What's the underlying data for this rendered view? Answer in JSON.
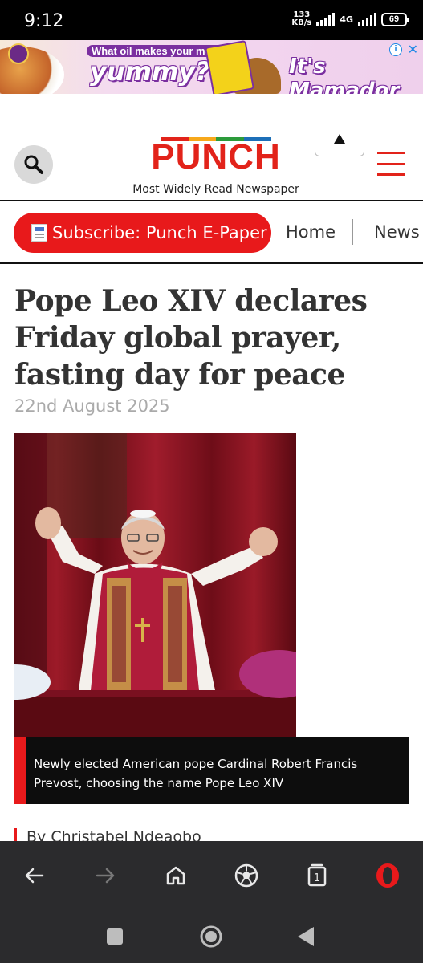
{
  "status_bar": {
    "time": "9:12",
    "net_speed_value": "133",
    "net_speed_unit": "KB/s",
    "network_type": "4G",
    "battery": "69"
  },
  "ad": {
    "question_line1": "What oil makes your meals",
    "question_line2": "yummy?",
    "cta": "It's Mamador",
    "info_icon": "info-icon",
    "close_icon": "close-icon"
  },
  "header": {
    "logo": "PUNCH",
    "tagline": "Most Widely Read Newspaper",
    "logo_colors": [
      "#e2231a",
      "#f7a81b",
      "#2c9b3b",
      "#1d6fb8"
    ]
  },
  "nav": {
    "subscribe_label": "Subscribe: Punch E-Paper",
    "home_label": "Home",
    "news_label": "News"
  },
  "article": {
    "headline": "Pope Leo XIV declares Friday global prayer, fasting day for peace",
    "date": "22nd August 2025",
    "caption": "Newly elected American pope Cardinal Robert Francis Prevost, choosing the name Pope Leo XIV",
    "byline": "By Christabel Ndeaobo"
  },
  "browser_toolbar": {
    "tab_count": "1",
    "icons": [
      "back-icon",
      "forward-icon",
      "home-icon",
      "football-icon",
      "tabs-icon",
      "opera-icon"
    ]
  },
  "colors": {
    "accent_red": "#e8191b",
    "logo_red": "#e2231a",
    "toolbar_bg": "#2b2b2d"
  }
}
